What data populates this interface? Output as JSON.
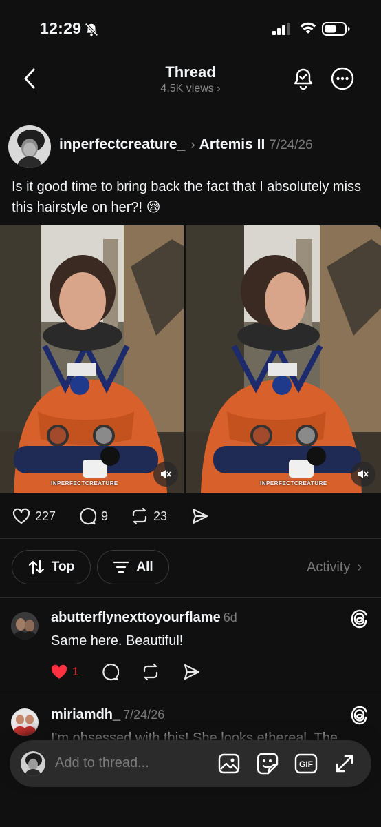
{
  "status_bar": {
    "time": "12:29"
  },
  "header": {
    "title": "Thread",
    "views": "4.5K views"
  },
  "post": {
    "username": "inperfectcreature_",
    "topic": "Artemis II",
    "date": "7/24/26",
    "text": "Is it good time to bring back the fact that I absolutely miss this hairstyle on her?! 😪",
    "media": [
      {
        "watermark": "INPERFECTCREATURE"
      },
      {
        "watermark": "INPERFECTCREATURE"
      }
    ],
    "likes": "227",
    "replies": "9",
    "reposts": "23"
  },
  "filters": {
    "sort_label": "Top",
    "filter_label": "All",
    "activity_label": "Activity"
  },
  "comments": [
    {
      "username": "abutterflynexttoyourflame",
      "date": "6d",
      "text": "Same here. Beautiful!",
      "likes": "1"
    },
    {
      "username": "miriamdh_",
      "date": "7/24/26",
      "text": "I'm obsessed with this! She looks ethereal. The"
    }
  ],
  "composer": {
    "placeholder": "Add to thread..."
  },
  "colors": {
    "background": "#101010",
    "like_red": "#ff3040",
    "suit_orange": "#d8602a"
  }
}
